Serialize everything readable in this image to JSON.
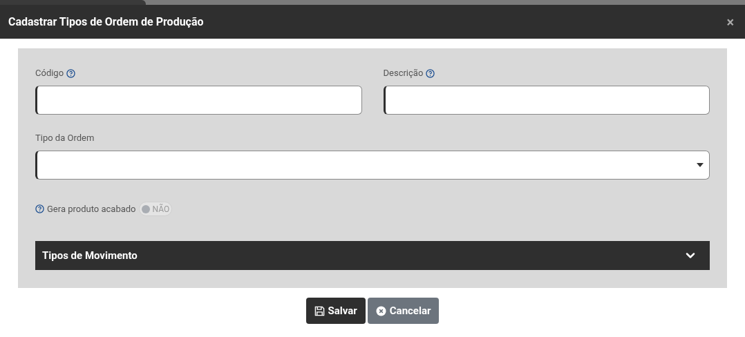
{
  "dialog": {
    "title": "Cadastrar Tipos de Ordem de Produção",
    "close": "×"
  },
  "fields": [
    {
      "label": "Código"
    },
    {
      "label": "Descrição"
    }
  ],
  "order_type": {
    "label": "Tipo da Ordem"
  },
  "toggle": {
    "label": "Gera produto acabado",
    "on": false,
    "state_text": "NÃO"
  },
  "section": {
    "title": "Tipos de Movimento",
    "expanded": false
  },
  "buttons": [
    {
      "kind": "save",
      "label": "Salvar"
    },
    {
      "kind": "cancel",
      "label": "Cancelar"
    }
  ]
}
